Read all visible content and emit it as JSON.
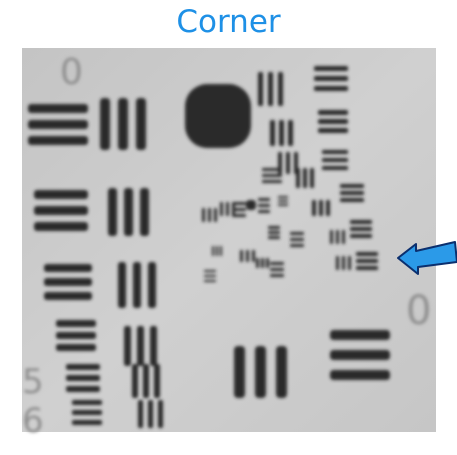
{
  "title": "Corner",
  "colors": {
    "title": "#1e90e6",
    "arrow": "#2b9ae8",
    "arrow_outline": "#0b2f6e",
    "background": "#c9c9c9",
    "bars": "#2a2a2a",
    "faint_digits": "#8c8c8c"
  },
  "icons": [
    "left-arrow-icon"
  ],
  "target": {
    "type": "USAF 1951 resolution test target",
    "blur": "moderate",
    "edge_digits": [
      "0",
      "5",
      "6",
      "0"
    ]
  }
}
